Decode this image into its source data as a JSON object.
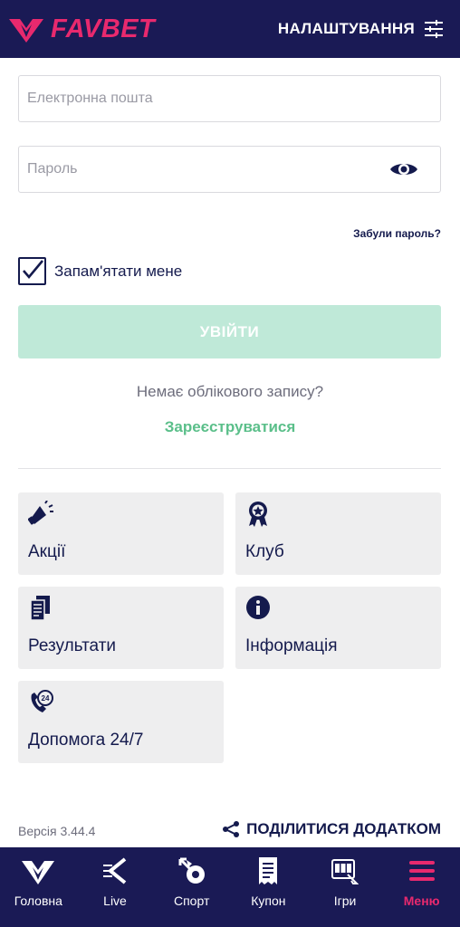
{
  "header": {
    "logo_text": "FAVBET",
    "settings_label": "НАЛАШТУВАННЯ"
  },
  "login": {
    "email_placeholder": "Електронна пошта",
    "email_value": "",
    "password_placeholder": "Пароль",
    "password_value": "",
    "forgot_label": "Забули пароль?",
    "remember_label": "Запам'ятати мене",
    "remember_checked": true,
    "submit_label": "УВІЙТИ",
    "no_account_text": "Немає облікового запису?",
    "register_label": "Зареєструватися"
  },
  "tiles": [
    {
      "label": "Акції",
      "icon": "megaphone-icon"
    },
    {
      "label": "Клуб",
      "icon": "award-badge-icon"
    },
    {
      "label": "Результати",
      "icon": "results-documents-icon"
    },
    {
      "label": "Інформація",
      "icon": "info-icon"
    },
    {
      "label": "Допомога 24/7",
      "icon": "support-24-icon"
    }
  ],
  "footer": {
    "version": "Версія 3.44.4",
    "share_label": "ПОДІЛИТИСЯ ДОДАТКОМ"
  },
  "bottom_nav": [
    {
      "label": "Головна",
      "icon": "home-logo-icon",
      "active": false
    },
    {
      "label": "Live",
      "icon": "live-icon",
      "active": false
    },
    {
      "label": "Спорт",
      "icon": "sport-icon",
      "active": false
    },
    {
      "label": "Купон",
      "icon": "coupon-receipt-icon",
      "active": false
    },
    {
      "label": "Ігри",
      "icon": "slot-machine-icon",
      "active": false
    },
    {
      "label": "Меню",
      "icon": "menu-icon",
      "active": true
    }
  ],
  "colors": {
    "brand_navy": "#1a1a55",
    "brand_pink": "#e8296e",
    "accent_green": "#5bbf8a",
    "disabled_green": "#bfe9d8",
    "tile_bg": "#eeeeef"
  }
}
